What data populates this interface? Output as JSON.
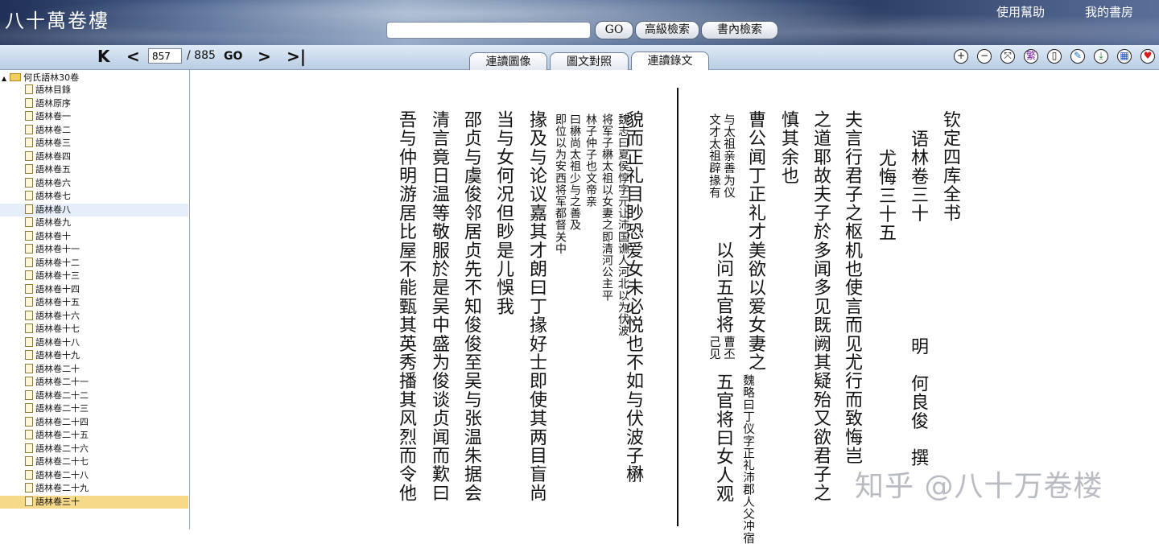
{
  "header": {
    "logo_text": "八十萬卷樓",
    "go_label": "GO",
    "advanced_search": "高級檢索",
    "in_book_search": "書內檢索",
    "help_link": "使用幫助",
    "my_shelf_link": "我的書房"
  },
  "toolbar": {
    "page_value": "857",
    "page_total": "/ 885",
    "go_label": "GO",
    "tabs": [
      "連讀圖像",
      "圖文對照",
      "連讀錄文"
    ],
    "icons": [
      "+",
      "−",
      "⤧",
      "繁",
      "▯",
      "✎",
      "⤓",
      "▦",
      "♥"
    ]
  },
  "sidebar": {
    "root": "何氏語林30卷",
    "items": [
      "語林目錄",
      "語林原序",
      "語林卷一",
      "語林卷二",
      "語林卷三",
      "語林卷四",
      "語林卷五",
      "語林卷六",
      "語林卷七",
      "語林卷八",
      "語林卷九",
      "語林卷十",
      "語林卷十一",
      "語林卷十二",
      "語林卷十三",
      "語林卷十四",
      "語林卷十五",
      "語林卷十六",
      "語林卷十七",
      "語林卷十八",
      "語林卷十九",
      "語林卷二十",
      "語林卷二十一",
      "語林卷二十二",
      "語林卷二十三",
      "語林卷二十四",
      "語林卷二十五",
      "語林卷二十六",
      "語林卷二十七",
      "語林卷二十八",
      "語林卷二十九",
      "語林卷三十"
    ]
  },
  "page_text": {
    "right": [
      "钦定四库全书",
      "语林卷三十",
      "尤悔三十五",
      "明",
      "何良俊",
      "撰",
      "夫言行君子之枢机也使言而见尤行而致悔岂",
      "之道耶故夫子於多闻多见既阙其疑殆又欲君子之",
      "慎其余也",
      "曹公闻丁正礼才美欲以爱女妻之",
      "以问五官将",
      "五官将曰女人观"
    ],
    "right_notes": [
      "与太祖亲善为仪",
      "文才太祖辟掾有",
      "曹丕",
      "己见",
      "魏略曰丁仪字正礼沛郡人父冲宿"
    ],
    "left": [
      "貌而正礼目眇恐爱女未必悦也不如与伏波子楙",
      "掾及与论议嘉其才朗曰丁掾好士即使其两目盲尚",
      "当与女何况但眇是儿悞我",
      "邵贞与虞俊邻居贞先不知俊俊至吴与张温朱据会",
      "清言竟日温等敬服於是吴中盛为俊谈贞闻而歎曰",
      "吾与仲明游居比屋不能甄其英秀播其风烈而令他"
    ],
    "left_notes": [
      "魏志曰夏侯惇字元让沛国谯人河北以为伏波",
      "将军子楙太祖以女妻之即清河公主平",
      "曰楙尚太祖少与之善及",
      "即位以为安西将军都督关中",
      "林子仲子也文帝亲"
    ]
  },
  "watermark": "知乎 @八十万卷楼"
}
